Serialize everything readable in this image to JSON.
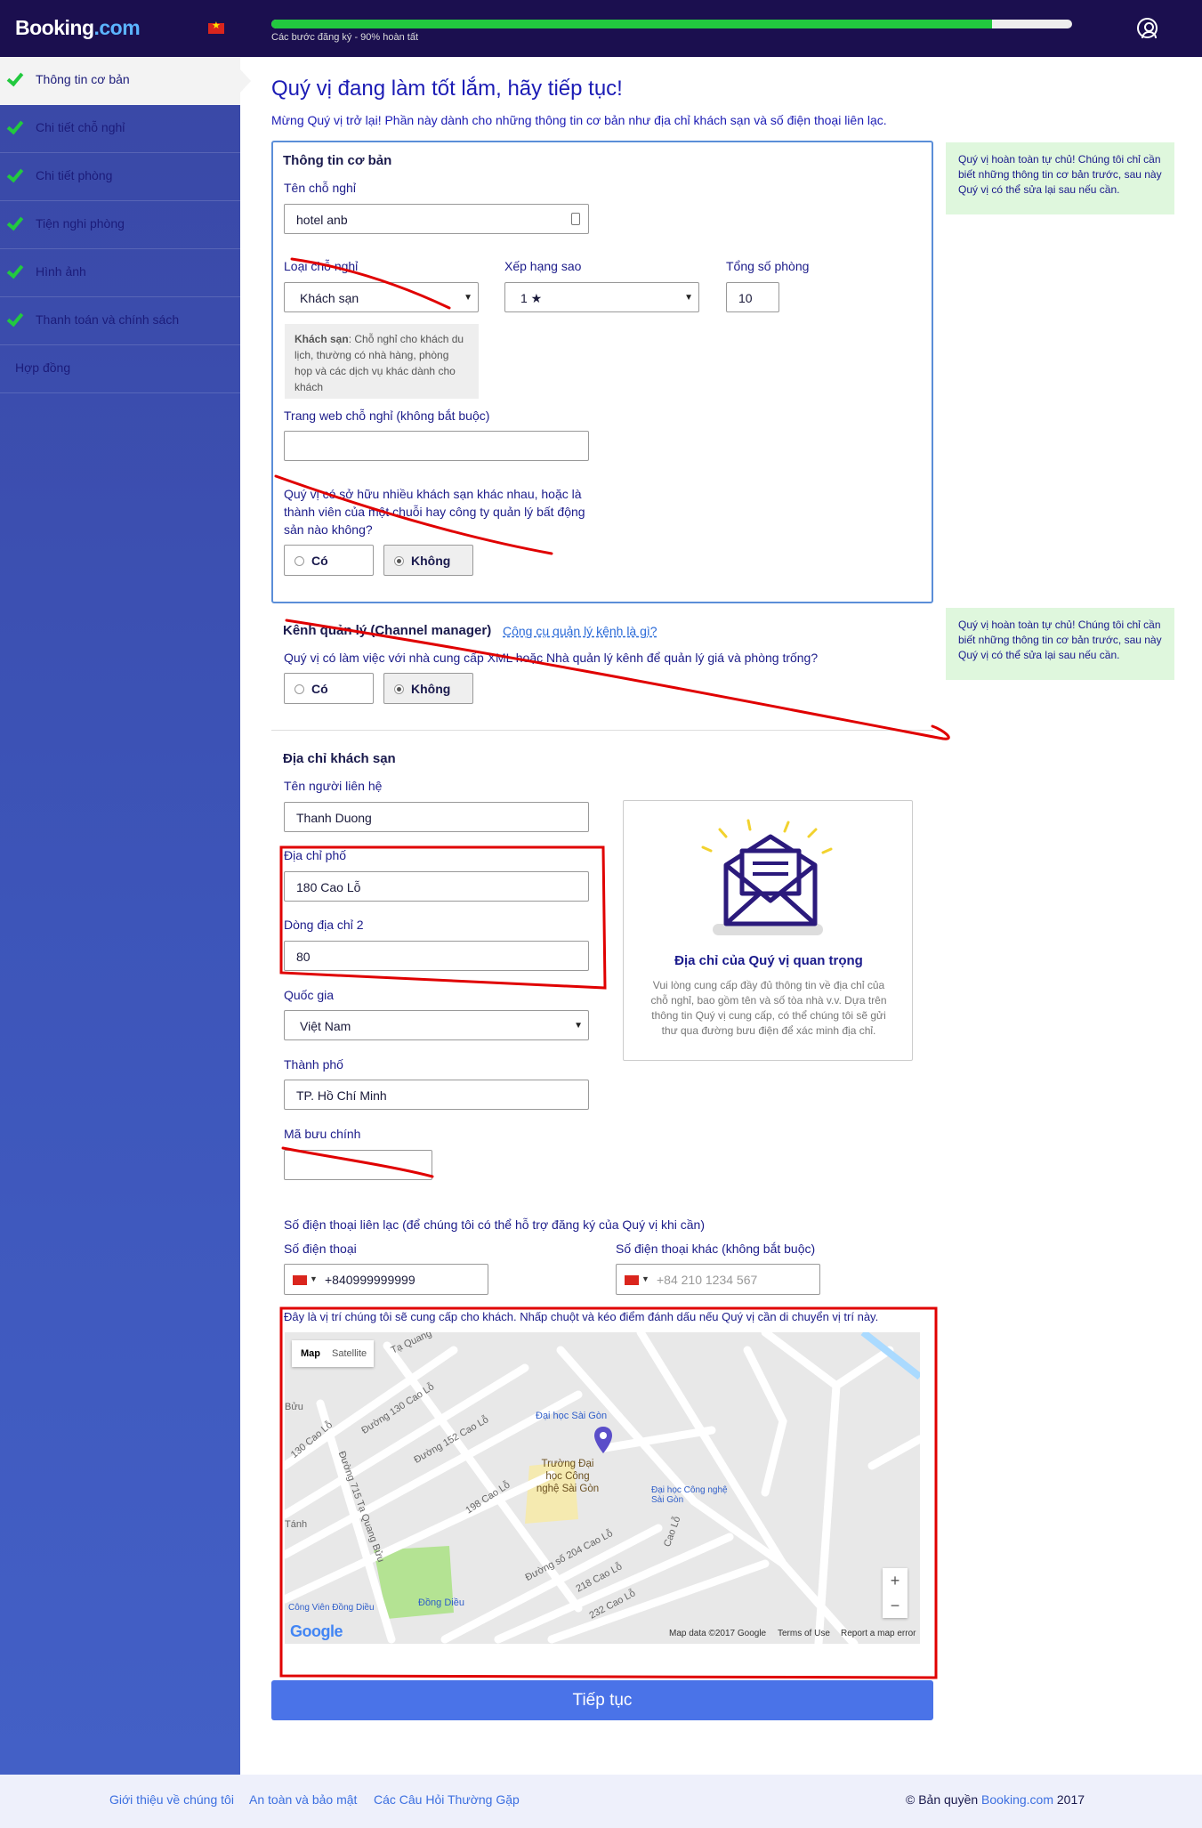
{
  "brand": {
    "name": "Booking",
    "suffix": ".com"
  },
  "progress": {
    "percent": 90,
    "label": "Các bước đăng ký - 90% hoàn tất"
  },
  "colors": {
    "topbar": "#1b0f4f",
    "progress": "#22c93f",
    "accent": "#4a73e8",
    "tip_bg": "#dff7dd",
    "annotation": "#e00000"
  },
  "sidebar": {
    "items": [
      {
        "label": "Thông tin cơ bản",
        "done": true,
        "active": true
      },
      {
        "label": "Chi tiết chỗ nghỉ",
        "done": true
      },
      {
        "label": "Chi tiết phòng",
        "done": true
      },
      {
        "label": "Tiện nghi phòng",
        "done": true
      },
      {
        "label": "Hình ảnh",
        "done": true
      },
      {
        "label": "Thanh toán và chính sách",
        "done": true
      },
      {
        "label": "Hợp đồng",
        "done": false
      }
    ]
  },
  "main": {
    "heading": "Quý vị đang làm tốt lắm, hãy tiếp tục!",
    "intro": "Mừng Quý vị trở lại! Phần này dành cho những thông tin cơ bản như địa chỉ khách sạn và số điện thoại liên lạc."
  },
  "basic": {
    "title": "Thông tin cơ bản",
    "name_label": "Tên chỗ nghỉ",
    "name_value": "hotel anb",
    "type_label": "Loại chỗ nghỉ",
    "type_value": "Khách sạn",
    "stars_label": "Xếp hạng sao",
    "stars_value": "1 ★",
    "rooms_label": "Tổng số phòng",
    "rooms_value": "10",
    "hint_bold": "Khách sạn",
    "hint_text": ": Chỗ nghỉ cho khách du lịch, thường có nhà hàng, phòng họp và các dịch vụ khác dành cho khách",
    "website_label": "Trang web chỗ nghỉ (không bắt buộc)",
    "website_value": "",
    "chain_question": "Quý vị có sở hữu nhiều khách sạn khác nhau, hoặc là thành viên của một chuỗi hay công ty quản lý bất động sản nào không?",
    "yes": "Có",
    "no": "Không",
    "selected": "no"
  },
  "tips": {
    "text": "Quý vị hoàn toàn tự chủ! Chúng tôi chỉ cần biết những thông tin cơ bản trước, sau này Quý vị có thể sửa lại sau nếu cần."
  },
  "channel": {
    "title": "Kênh quản lý (Channel manager)",
    "link": "Công cụ quản lý kênh là gì?",
    "question": "Quý vị có làm việc với nhà cung cấp XML hoặc Nhà quản lý kênh để quản lý giá và phòng trống?",
    "yes": "Có",
    "no": "Không",
    "selected": "no"
  },
  "address": {
    "title": "Địa chỉ khách sạn",
    "contact_label": "Tên người liên hệ",
    "contact_value": "Thanh Duong",
    "street_label": "Địa chỉ phố",
    "street_value": "180 Cao Lỗ",
    "line2_label": "Dòng địa chỉ 2",
    "line2_value": "80",
    "country_label": "Quốc gia",
    "country_value": "Việt Nam",
    "city_label": "Thành phố",
    "city_value": "TP. Hồ Chí Minh",
    "zip_label": "Mã bưu chính",
    "zip_value": "",
    "card_title": "Địa chỉ của Quý vị quan trọng",
    "card_text": "Vui lòng cung cấp đầy đủ thông tin về địa chỉ của chỗ nghỉ, bao gồm tên và số tòa nhà v.v. Dựa trên thông tin Quý vị cung cấp, có thể chúng tôi sẽ gửi thư qua đường bưu điện để xác minh địa chỉ."
  },
  "phones": {
    "title": "Số điện thoại liên lạc (để chúng tôi có thể hỗ trợ đăng ký của Quý vị khi cần)",
    "phone_label": "Số điện thoại",
    "phone_value": "+840999999999",
    "alt_label": "Số điện thoại khác (không bắt buộc)",
    "alt_placeholder": "+84 210 1234 567"
  },
  "map": {
    "instruction": "Đây là vị trí chúng tôi sẽ cung cấp cho khách. Nhấp chuột và kéo điểm đánh dấu nếu Quý vị cần di chuyển vị trí này.",
    "tab_map": "Map",
    "tab_satellite": "Satellite",
    "zoom_in": "+",
    "zoom_out": "−",
    "google": "Google",
    "map_data": "Map data ©2017 Google",
    "terms": "Terms of Use",
    "report": "Report a map error",
    "labels": {
      "l1": "Tạ Quang",
      "l2": "Đường 130 Cao Lỗ",
      "l3": "Đường 152 Cao Lỗ",
      "l4": "Đại học Sài Gòn",
      "l5": "Trường Đại học Công nghệ Sài Gòn",
      "l6": "Đại học Công nghệ Sài Gòn",
      "l7": "130 Cao Lỗ",
      "l8": "Bửu",
      "l9": "Đường 715 Tạ Quang Bửu",
      "l10": "198 Cao Lỗ",
      "l11": "Tánh",
      "l12": "Đường số 204 Cao Lỗ",
      "l13": "218 Cao Lỗ",
      "l14": "232 Cao Lỗ",
      "l15": "Cao Lỗ",
      "l16": "Công Viên Đồng Diều",
      "l17": "Đồng Diều"
    }
  },
  "submit": "Tiếp tục",
  "footer": {
    "about": "Giới thiệu về chúng tôi",
    "safety": "An toàn và bảo mật",
    "faq": "Các Câu Hỏi Thường Gặp",
    "copyright": "© Bản quyền",
    "brand": "Booking.com",
    "year": "2017"
  }
}
